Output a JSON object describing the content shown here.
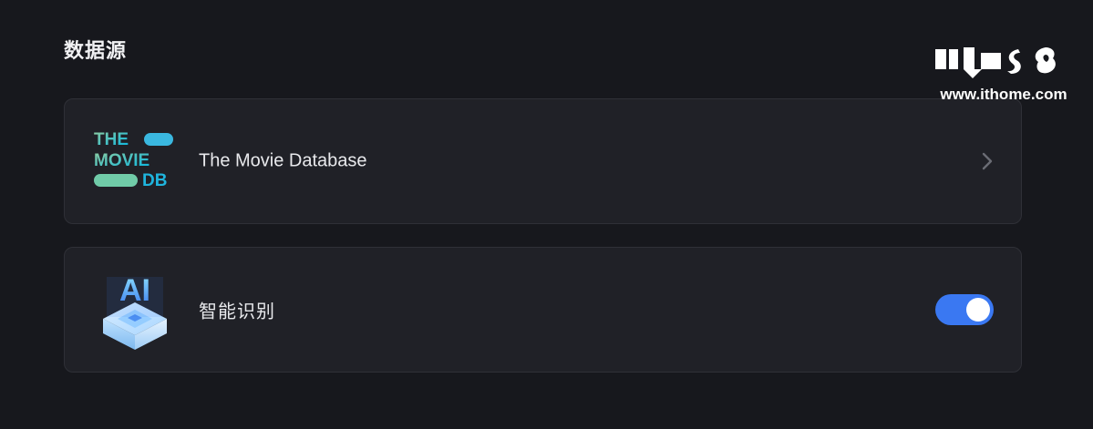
{
  "section": {
    "title": "数据源"
  },
  "sources": [
    {
      "label": "The Movie Database",
      "icon": "tmdb-logo",
      "logo_text": [
        "THE",
        "MOVIE",
        "DB"
      ]
    },
    {
      "label": "智能识别",
      "icon": "ai-chip-icon",
      "icon_text": "AI",
      "toggle_on": true
    }
  ],
  "watermark": {
    "url": "www.ithome.com"
  },
  "colors": {
    "background": "#17181d",
    "card": "#202127",
    "accent": "#3a78f2",
    "tmdb_green": "#8ed1a2",
    "tmdb_blue": "#20b3e0"
  }
}
